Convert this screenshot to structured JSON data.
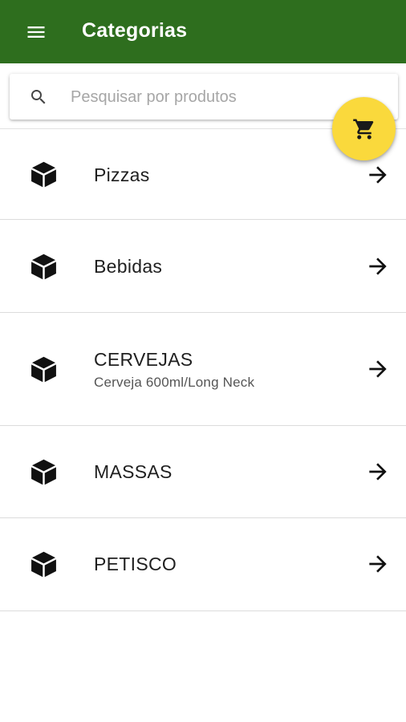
{
  "appbar": {
    "title": "Categorias",
    "color": "#2e6e1e",
    "menu_icon": "menu-icon"
  },
  "search": {
    "placeholder": "Pesquisar por produtos",
    "value": "",
    "icon": "search-icon"
  },
  "fab": {
    "icon": "cart-icon",
    "color": "#fad93c"
  },
  "categories": [
    {
      "title": "Pizzas",
      "subtitle": ""
    },
    {
      "title": "Bebidas",
      "subtitle": ""
    },
    {
      "title": "CERVEJAS",
      "subtitle": "Cerveja 600ml/Long Neck"
    },
    {
      "title": "MASSAS",
      "subtitle": ""
    },
    {
      "title": "PETISCO",
      "subtitle": ""
    }
  ]
}
